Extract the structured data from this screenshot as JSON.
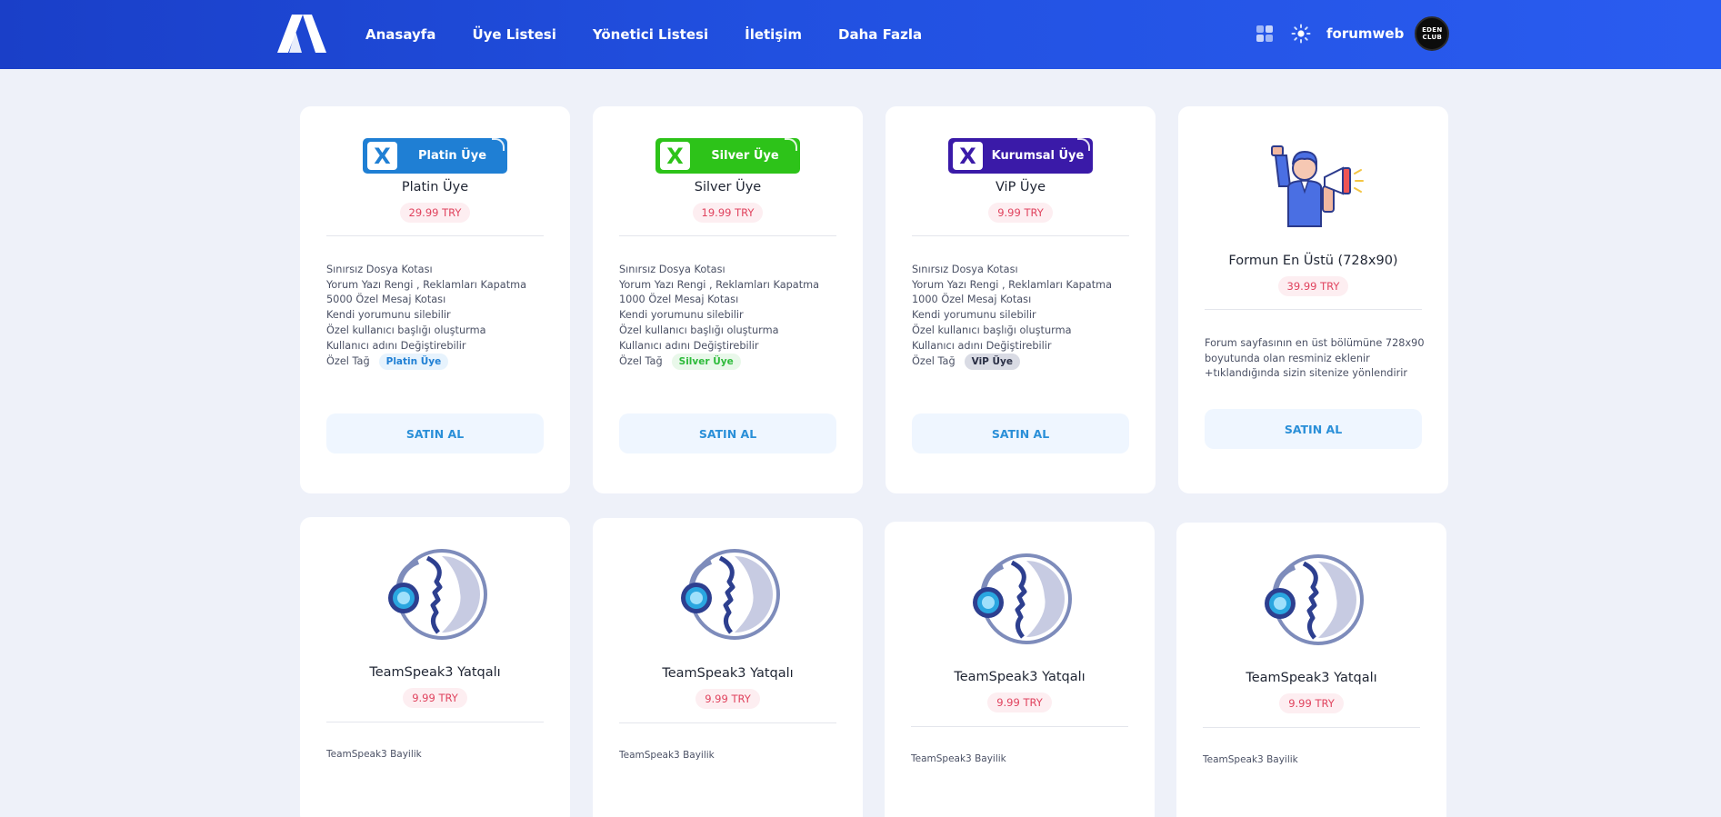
{
  "nav": {
    "items": [
      "Anasayfa",
      "Üye Listesi",
      "Yönetici Listesi",
      "İletişim",
      "Daha Fazla"
    ],
    "username": "forumweb",
    "avatar_text": [
      "EDEN",
      "CLUB"
    ]
  },
  "cards": [
    {
      "badge_text": "Platin Üye",
      "badge_color": "#1f7fd4",
      "title": "Platin Üye",
      "price": "29.99 TRY",
      "features": [
        "Sınırsız Dosya Kotası",
        "Yorum Yazı Rengi , Reklamları Kapatma",
        "5000 Özel Mesaj Kotası",
        "Kendi yorumunu silebilir",
        "Özel kullanıcı başlığı oluşturma",
        "Kullanıcı adını Değiştirebilir"
      ],
      "tag_label": "Özel Tağ",
      "tag_text": "Platin Üye",
      "tag_fg": "#1f7fd4",
      "tag_bg": "#e7f3fd",
      "button": "SATIN AL"
    },
    {
      "badge_text": "Silver Üye",
      "badge_color": "#2dc319",
      "title": "Silver Üye",
      "price": "19.99 TRY",
      "features": [
        "Sınırsız Dosya Kotası",
        "Yorum Yazı Rengi , Reklamları Kapatma",
        "1000 Özel Mesaj Kotası",
        "Kendi yorumunu silebilir",
        "Özel kullanıcı başlığı oluşturma",
        "Kullanıcı adını Değiştirebilir"
      ],
      "tag_label": "Özel Tağ",
      "tag_text": "Silver Üye",
      "tag_fg": "#2dbb3a",
      "tag_bg": "#e9f8ea",
      "button": "SATIN AL"
    },
    {
      "badge_text": "Kurumsal Üye",
      "badge_color": "#3a1aa8",
      "title": "ViP Üye",
      "price": "9.99 TRY",
      "features": [
        "Sınırsız Dosya Kotası",
        "Yorum Yazı Rengi , Reklamları Kapatma",
        "1000 Özel Mesaj Kotası",
        "Kendi yorumunu silebilir",
        "Özel kullanıcı başlığı oluşturma",
        "Kullanıcı adını Değiştirebilir"
      ],
      "tag_label": "Özel Tağ",
      "tag_text": "ViP Üye",
      "tag_fg": "#2a2f45",
      "tag_bg": "#d9dbe4",
      "button": "SATIN AL"
    },
    {
      "title": "Formun En Üstü (728x90)",
      "price": "39.99 TRY",
      "description": "Forum sayfasının en üst bölümüne 728x90 boyutunda olan resminiz eklenir +tıklandığında sizin sitenize yönlendirir",
      "button": "SATIN AL"
    }
  ],
  "ts_cards": [
    {
      "title": "TeamSpeak3 Yatqalı",
      "price": "9.99 TRY",
      "description": "TeamSpeak3 Bayilik"
    },
    {
      "title": "TeamSpeak3 Yatqalı",
      "price": "9.99 TRY",
      "description": "TeamSpeak3 Bayilik"
    },
    {
      "title": "TeamSpeak3 Yatqalı",
      "price": "9.99 TRY",
      "description": "TeamSpeak3 Bayilik"
    },
    {
      "title": "TeamSpeak3 Yatqalı",
      "price": "9.99 TRY",
      "description": "TeamSpeak3 Bayilik"
    }
  ],
  "colors": {
    "header": "#1f4ad8",
    "price_text": "#e0435e",
    "button_text": "#2a8fd8",
    "background": "#eef1f9"
  }
}
